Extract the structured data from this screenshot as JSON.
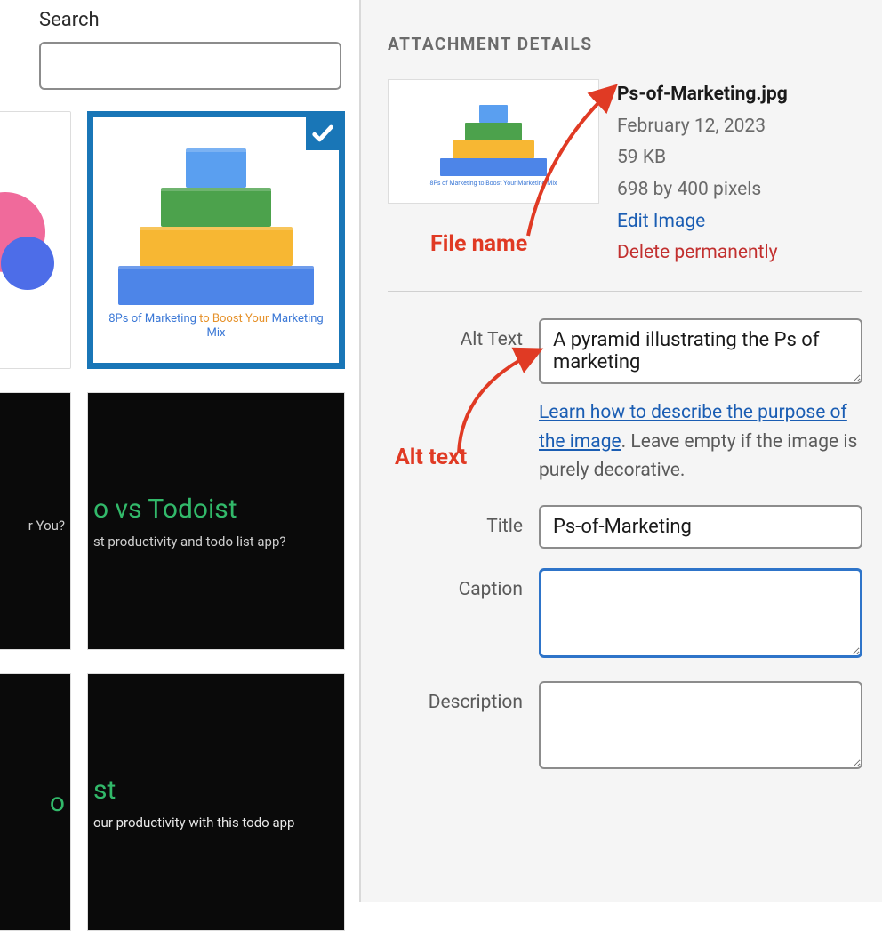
{
  "left": {
    "search_label": "Search",
    "search_value": "",
    "thumb2_caption_part1": "8Ps of Marketing ",
    "thumb2_caption_part2": "to Boost Your ",
    "thumb2_caption_part3": "Marketing Mix",
    "thumb3_title_fragment": "r You?",
    "thumb4_title": "o vs Todoist",
    "thumb4_sub": "st productivity and todo list app?",
    "thumb5_title_fragment": "o",
    "thumb6_title": "st",
    "thumb6_sub": "our productivity with this todo app"
  },
  "details": {
    "header": "ATTACHMENT DETAILS",
    "filename": "Ps-of-Marketing.jpg",
    "date": "February 12, 2023",
    "size": "59 KB",
    "dimensions": "698 by 400 pixels",
    "edit_link": "Edit Image",
    "delete_link": "Delete permanently",
    "preview_caption": "8Ps of Marketing to Boost Your Marketing Mix"
  },
  "form": {
    "alt_label": "Alt Text",
    "alt_value": "A pyramid illustrating the Ps of marketing",
    "alt_help_link": "Learn how to describe the purpose of the image",
    "alt_help_rest": ". Leave empty if the image is purely decorative.",
    "title_label": "Title",
    "title_value": "Ps-of-Marketing",
    "caption_label": "Caption",
    "caption_value": "",
    "description_label": "Description",
    "description_value": ""
  },
  "annotations": {
    "filename_label": "File name",
    "alttext_label": "Alt text"
  }
}
